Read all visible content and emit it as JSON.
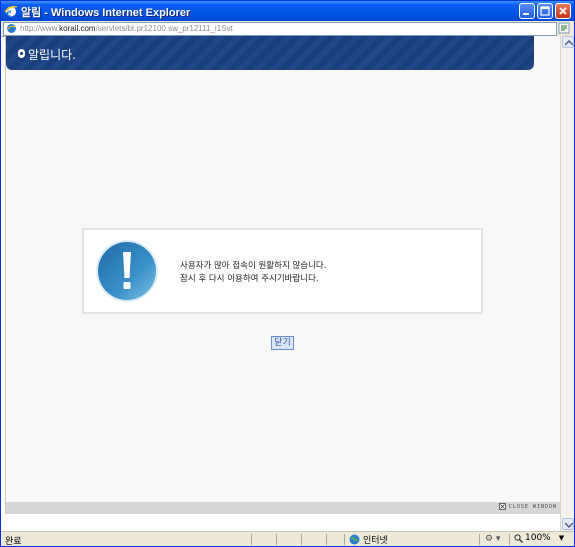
{
  "window": {
    "title": "알림 - Windows Internet Explorer",
    "minimize_icon": "minimize-icon",
    "maximize_icon": "maximize-icon",
    "close_icon": "close-icon"
  },
  "address": {
    "prefix": "http://www.",
    "domain": "korail.com",
    "path": "/servlets/bt.pr12100.sw_pr12111_i1Svt"
  },
  "banner": {
    "title": "알립니다."
  },
  "message": {
    "line1": "사용자가 많아 접속이 원활하지 않습니다.",
    "line2": "잠시 후 다시 이용하여 주시기바랍니다.",
    "icon": "exclamation-icon"
  },
  "buttons": {
    "close": "닫기"
  },
  "footer": {
    "close_window": "CLOSE WINDOW"
  },
  "statusbar": {
    "status": "완료",
    "zone": "인터넷",
    "zoom": "100%"
  },
  "colors": {
    "titlebar": "#0055e5",
    "banner": "#1b3e7c",
    "icon_blue": "#3a8fc8"
  }
}
